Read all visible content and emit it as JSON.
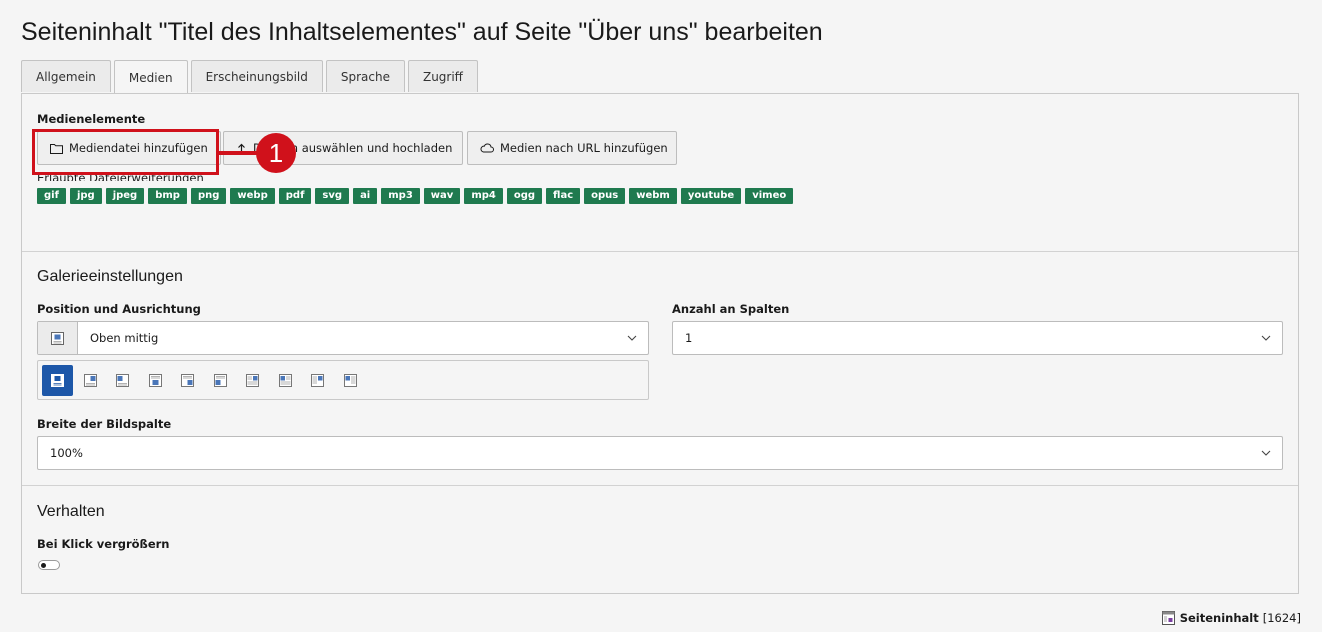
{
  "page": {
    "title": "Seiteninhalt \"Titel des Inhaltselementes\" auf Seite \"Über uns\" bearbeiten"
  },
  "tabs": [
    {
      "label": "Allgemein",
      "active": false
    },
    {
      "label": "Medien",
      "active": true
    },
    {
      "label": "Erscheinungsbild",
      "active": false
    },
    {
      "label": "Sprache",
      "active": false
    },
    {
      "label": "Zugriff",
      "active": false
    }
  ],
  "media": {
    "section_label": "Medienelemente",
    "add_file_button": "Mediendatei hinzufügen",
    "upload_button": "Dateien auswählen und hochladen",
    "url_button": "Medien nach URL hinzufügen",
    "allowed_caption": "Erlaubte Dateierweiterungen",
    "extensions": [
      "gif",
      "jpg",
      "jpeg",
      "bmp",
      "png",
      "webp",
      "pdf",
      "svg",
      "ai",
      "mp3",
      "wav",
      "mp4",
      "ogg",
      "flac",
      "opus",
      "webm",
      "youtube",
      "vimeo"
    ]
  },
  "gallery": {
    "title": "Galerieeinstellungen",
    "position_label": "Position und Ausrichtung",
    "position_value": "Oben mittig",
    "position_options_active_index": 0,
    "columns_label": "Anzahl an Spalten",
    "columns_value": "1",
    "width_label": "Breite der Bildspalte",
    "width_value": "100%"
  },
  "behavior": {
    "title": "Verhalten",
    "enlarge_label": "Bei Klick vergrößern",
    "enlarge_enabled": false
  },
  "annotation": {
    "step_number": "1",
    "color": "#d0111b"
  },
  "footer": {
    "record_type": "Seiteninhalt",
    "record_id": "[1624]"
  },
  "colors": {
    "badge": "#1f7a4f",
    "active_option": "#1d57a8"
  },
  "icons": {
    "add_file": "folder-icon",
    "upload": "upload-icon",
    "url": "cloud-icon",
    "dropdown": "chevron-down-icon",
    "record": "content-element-icon"
  }
}
